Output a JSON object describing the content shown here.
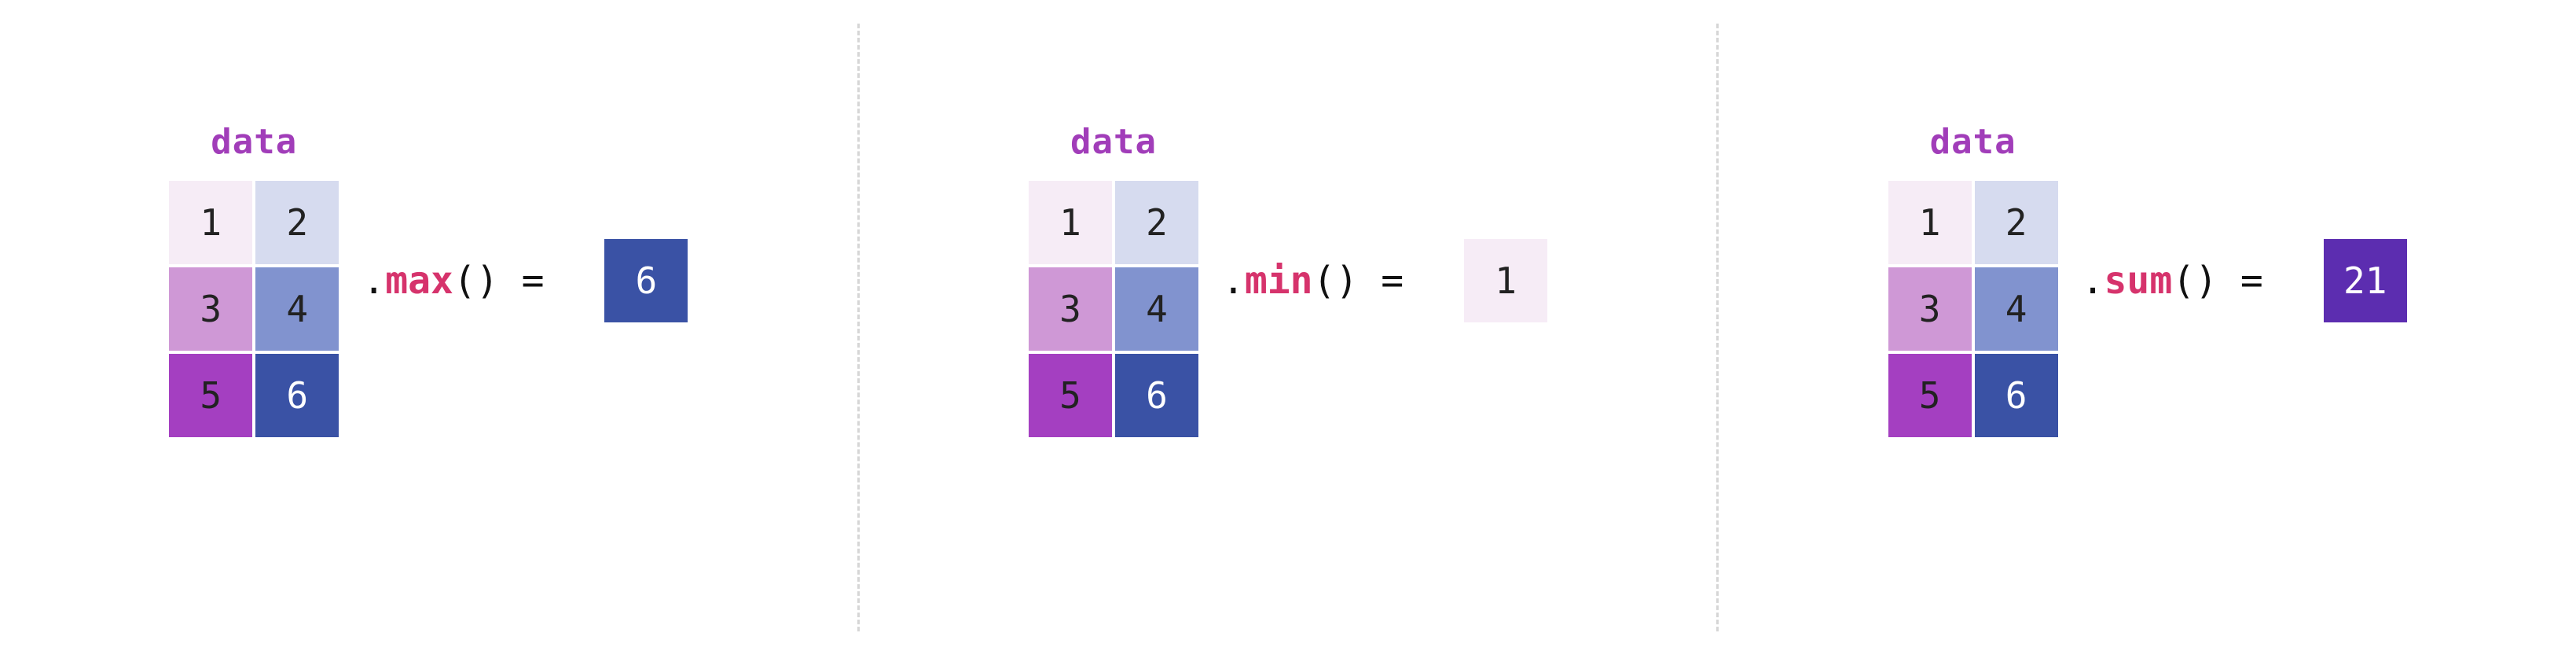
{
  "colors": {
    "title": "#a13db9",
    "fn": "#d6336c",
    "sep": "#d6d6d6"
  },
  "cell_palette": {
    "c1": "#f6ecf6",
    "c2": "#d6dbef",
    "c3": "#cf98d6",
    "c4": "#8193cf",
    "c5": "#a43fc1",
    "c6": "#3a52a5",
    "r_max": "#3a52a5",
    "r_min": "#f6ecf6",
    "r_sum": "#5c2db0"
  },
  "panels": [
    {
      "title": "data",
      "cells": [
        {
          "v": "1",
          "bg": "c1",
          "fg": "light"
        },
        {
          "v": "2",
          "bg": "c2",
          "fg": "light"
        },
        {
          "v": "3",
          "bg": "c3",
          "fg": "light"
        },
        {
          "v": "4",
          "bg": "c4",
          "fg": "light"
        },
        {
          "v": "5",
          "bg": "c5",
          "fg": "light"
        },
        {
          "v": "6",
          "bg": "c6",
          "fg": "dark"
        }
      ],
      "op": {
        "dot": ".",
        "fn": "max",
        "paren": "()",
        "eq": " = "
      },
      "result": {
        "v": "6",
        "bg": "r_max",
        "fg": "dark"
      }
    },
    {
      "title": "data",
      "cells": [
        {
          "v": "1",
          "bg": "c1",
          "fg": "light"
        },
        {
          "v": "2",
          "bg": "c2",
          "fg": "light"
        },
        {
          "v": "3",
          "bg": "c3",
          "fg": "light"
        },
        {
          "v": "4",
          "bg": "c4",
          "fg": "light"
        },
        {
          "v": "5",
          "bg": "c5",
          "fg": "light"
        },
        {
          "v": "6",
          "bg": "c6",
          "fg": "dark"
        }
      ],
      "op": {
        "dot": ".",
        "fn": "min",
        "paren": "()",
        "eq": " = "
      },
      "result": {
        "v": "1",
        "bg": "r_min",
        "fg": "light"
      }
    },
    {
      "title": "data",
      "cells": [
        {
          "v": "1",
          "bg": "c1",
          "fg": "light"
        },
        {
          "v": "2",
          "bg": "c2",
          "fg": "light"
        },
        {
          "v": "3",
          "bg": "c3",
          "fg": "light"
        },
        {
          "v": "4",
          "bg": "c4",
          "fg": "light"
        },
        {
          "v": "5",
          "bg": "c5",
          "fg": "light"
        },
        {
          "v": "6",
          "bg": "c6",
          "fg": "dark"
        }
      ],
      "op": {
        "dot": ".",
        "fn": "sum",
        "paren": "()",
        "eq": " = "
      },
      "result": {
        "v": "21",
        "bg": "r_sum",
        "fg": "dark"
      }
    }
  ]
}
